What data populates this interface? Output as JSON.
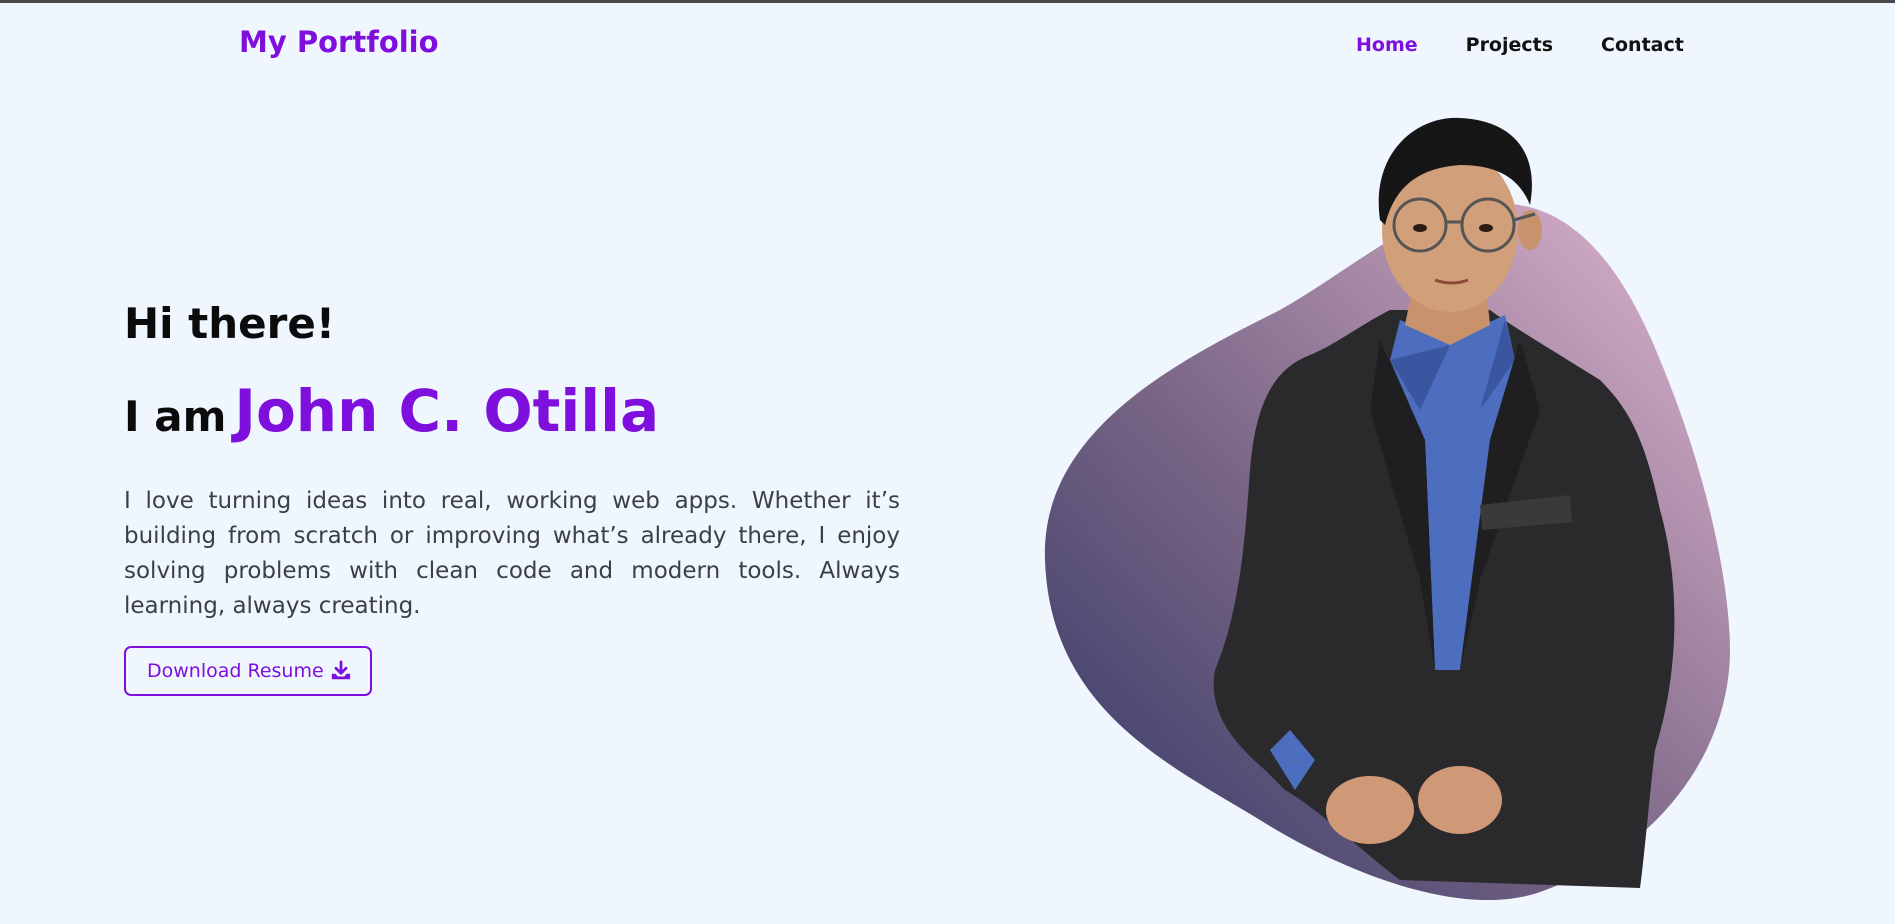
{
  "navbar": {
    "brand": "My Portfolio",
    "links": [
      {
        "label": "Home",
        "active": true
      },
      {
        "label": "Projects",
        "active": false
      },
      {
        "label": "Contact",
        "active": false
      }
    ]
  },
  "hero": {
    "greeting": "Hi there!",
    "intro_lead": "I am",
    "name": "John C. Otilla",
    "bio": "I love turning ideas into real, working web apps. Whether it’s building from scratch or improving what’s already there, I enjoy solving problems with clean code and modern tools. Always learning, always creating.",
    "resume_button_label": "Download Resume",
    "resume_button_icon": "download-icon",
    "portrait_alt": "portrait photo"
  },
  "colors": {
    "accent": "#7f0fdc",
    "background": "#eff6fe",
    "blob_dark": "#3a3865",
    "blob_light": "#d9b3cf"
  }
}
